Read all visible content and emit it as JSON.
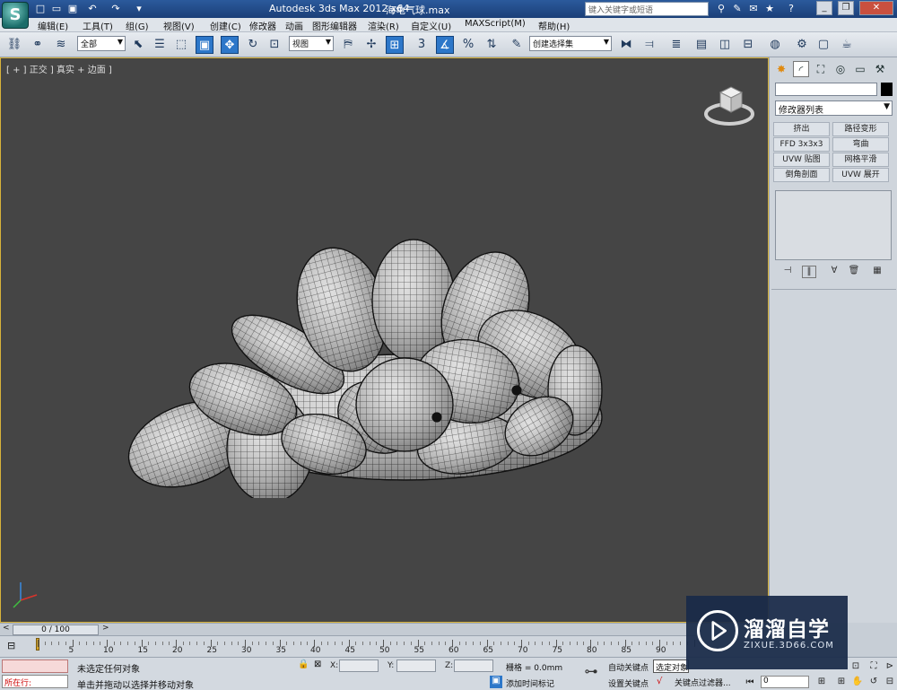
{
  "title_bar": {
    "app_title": "Autodesk 3ds Max  2012 x64",
    "file_title": "海龟气球.max",
    "search_placeholder": "键入关键字或短语"
  },
  "menu": [
    "编辑(E)",
    "工具(T)",
    "组(G)",
    "视图(V)",
    "创建(C)",
    "修改器",
    "动画",
    "图形编辑器",
    "渲染(R)",
    "自定义(U)",
    "MAXScript(M)",
    "帮助(H)"
  ],
  "toolbar": {
    "selection_filter": "全部",
    "reference_coord": "视图",
    "named_selection": "创建选择集",
    "snap_label": "3"
  },
  "viewport": {
    "label": "[ + ] 正交 ] 真实 + 边面 ]"
  },
  "command_panel": {
    "modifier_list": "修改器列表",
    "modifier_buttons": [
      "挤出",
      "路径变形",
      "FFD 3x3x3",
      "弯曲",
      "UVW 贴图",
      "网格平滑",
      "倒角剖面",
      "UVW 展开"
    ]
  },
  "time_slider": {
    "position": "0 / 100",
    "ticks": [
      "5",
      "10",
      "15",
      "20",
      "25",
      "30",
      "35",
      "40",
      "45",
      "50",
      "55",
      "60",
      "65",
      "70",
      "75",
      "80",
      "85",
      "90"
    ]
  },
  "status": {
    "selection": "未选定任何对象",
    "prompt": "单击并拖动以选择并移动对象",
    "running": "所在行:",
    "x_label": "X:",
    "y_label": "Y:",
    "z_label": "Z:",
    "grid": "栅格 = 0.0mm",
    "add_time_tag": "添加时间标记",
    "auto_key": "自动关键点",
    "set_key": "设置关键点",
    "selected_dropdown": "选定对象",
    "key_filters": "关键点过滤器...",
    "frame": "0"
  },
  "watermark": {
    "title": "溜溜自学",
    "url": "ZIXUE.3D66.COM"
  }
}
